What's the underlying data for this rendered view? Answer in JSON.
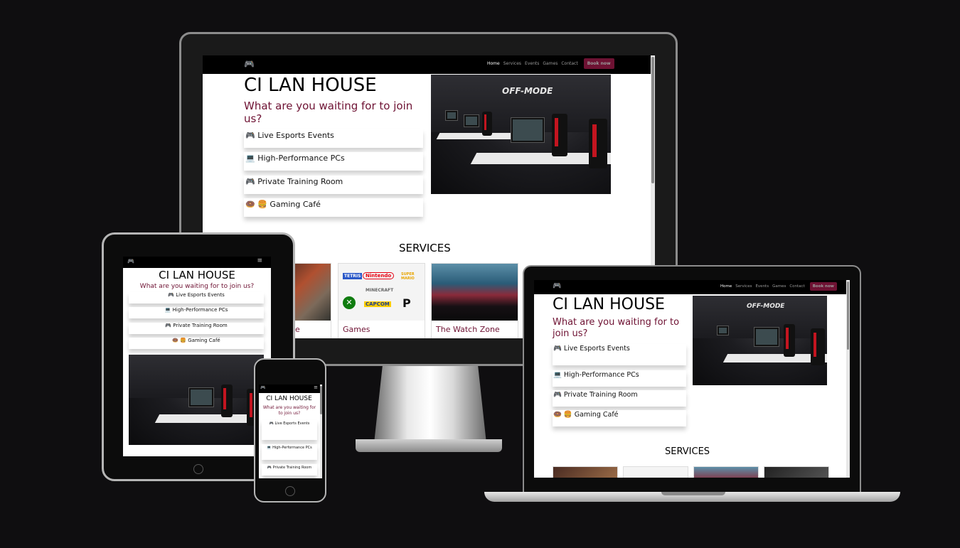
{
  "site": {
    "nav": {
      "links": [
        "Home",
        "Services",
        "Events",
        "Games",
        "Contact"
      ],
      "book_label": "Book now"
    },
    "hero": {
      "title": "CI LAN HOUSE",
      "tagline": "What are you waiting for to join us?",
      "features": [
        {
          "icon": "🎮",
          "label": "Live Esports Events",
          "icon_name": "esports-icon"
        },
        {
          "icon": "💻",
          "label": "High-Performance PCs",
          "icon_name": "computer-icon"
        },
        {
          "icon": "🎮",
          "label": "Private Training Room",
          "icon_name": "gamepad-icon"
        },
        {
          "icon": "🍩 🍔",
          "label": "Gaming Café",
          "icon_name": "food-icon"
        }
      ]
    },
    "photo": {
      "sign_text": "OFF-MODE"
    },
    "services": {
      "heading": "SERVICES",
      "cards": [
        {
          "label": "Lounge"
        },
        {
          "label": "Games"
        },
        {
          "label": "The Watch Zone"
        }
      ],
      "visible_partial_label": "e"
    },
    "game_logos": [
      "TETRIS",
      "Nintendo",
      "SUPER MARIO",
      "MINECRAFT",
      "XBOX",
      "CAPCOM",
      "PlayStation"
    ]
  },
  "colors": {
    "accent": "#6e1233",
    "background": "#0f0e10",
    "nav": "#000000"
  }
}
